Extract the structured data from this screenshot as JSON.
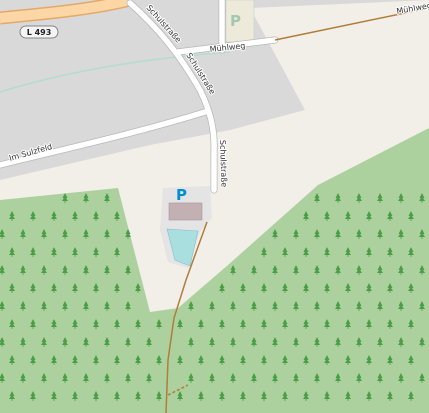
{
  "map": {
    "roads": {
      "l493_ref": "L 493",
      "schulstrasse": "Schulstraße",
      "muehlweg": "Mühlweg",
      "im_sulzfeld": "Im Sulzfeld"
    },
    "poi": {
      "parking_symbol": "P",
      "parking_icon": "parking-icon"
    },
    "colors": {
      "background": "#f2efe9",
      "residential": "#d9d9d9",
      "forest": "#add19e",
      "forest_symbol": "#4a9e46",
      "road": "#ffffff",
      "road_casing": "#b8b8b8",
      "secondary_road": "#fcd6a4",
      "track": "#b07d3a",
      "parking": "#eeeeee",
      "building": "#c2b0b3",
      "water": "#aad3df",
      "parking_text": "#0090d0"
    }
  }
}
